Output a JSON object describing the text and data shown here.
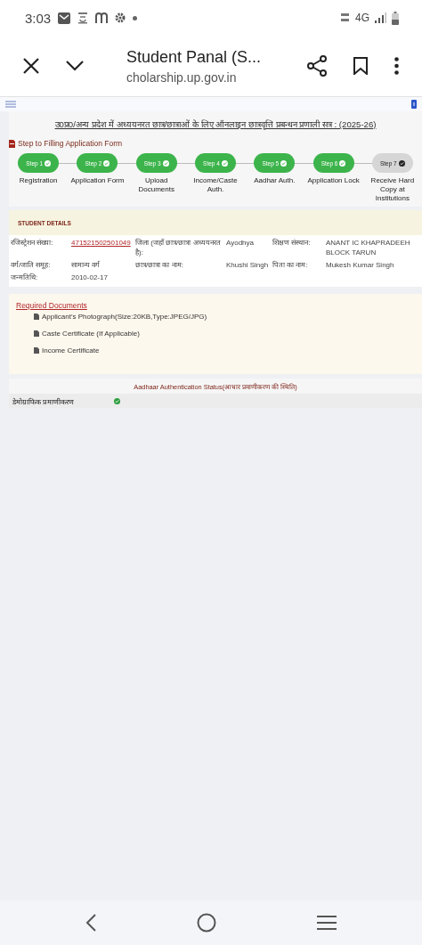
{
  "status_bar": {
    "time": "3:03",
    "network": "4G"
  },
  "browser": {
    "title": "Student Panal (S...",
    "url": "cholarship.up.gov.in"
  },
  "page": {
    "heading": "उ0प्र0/अन्य प्रदेश में अध्ययनरत छात्र/छात्राओं के लिए ऑनलाइन छात्रवृत्ति प्रबन्धन प्रणाली सत्र : (2025-26)",
    "steps_title": "Step to Filling Application Form",
    "steps": [
      {
        "label": "Step 1",
        "caption": "Registration",
        "done": true
      },
      {
        "label": "Step 2",
        "caption": "Application Form",
        "done": true
      },
      {
        "label": "Step 3",
        "caption": "Upload Documents",
        "done": true
      },
      {
        "label": "Step 4",
        "caption": "Income/Caste Auth.",
        "done": true
      },
      {
        "label": "Step 5",
        "caption": "Aadhar Auth.",
        "done": true
      },
      {
        "label": "Step 6",
        "caption": "Application Lock",
        "done": true
      },
      {
        "label": "Step 7",
        "caption": "Receive Hard Copy at Institutions",
        "done": false
      }
    ],
    "student_details": {
      "title": "STUDENT DETAILS",
      "rows": [
        [
          {
            "label": "रजिस्ट्रेशन संख्या:",
            "value": "471521502501049",
            "kind": "link"
          },
          {
            "label": "जिला (जहाँ छात्र/छात्रा अध्ययनरत है):",
            "value": "Ayodhya",
            "kind": "text"
          },
          {
            "label": "शिक्षण संस्थान:",
            "value": "ANANT IC KHAPRADEEH BLOCK TARUN",
            "kind": "text"
          }
        ],
        [
          {
            "label": "वर्ग/जाति समूह:",
            "value": "सामान्य वर्ग",
            "kind": "text"
          },
          {
            "label": "छात्र/छात्रा का नाम:",
            "value": "Khushi Singh",
            "kind": "text"
          },
          {
            "label": "पिता का नाम:",
            "value": "Mukesh Kumar Singh",
            "kind": "text"
          }
        ],
        [
          {
            "label": "जन्मतिथि:",
            "value": "2010-02-17",
            "kind": "text"
          }
        ]
      ]
    },
    "required_documents": {
      "title": "Required Documents",
      "items": [
        "Applicant's Photograph(Size:20KB,Type:JPEG/JPG)",
        "Caste Certificate (If Applicable)",
        "Income Certificate"
      ]
    },
    "aadhaar": {
      "title": "Aadhaar Authentication Status(आधार प्रमाणीकरण की स्थिति)",
      "rows": [
        {
          "label": "डेमोग्राफिक प्रमाणीकरण",
          "verified": true
        }
      ]
    }
  }
}
